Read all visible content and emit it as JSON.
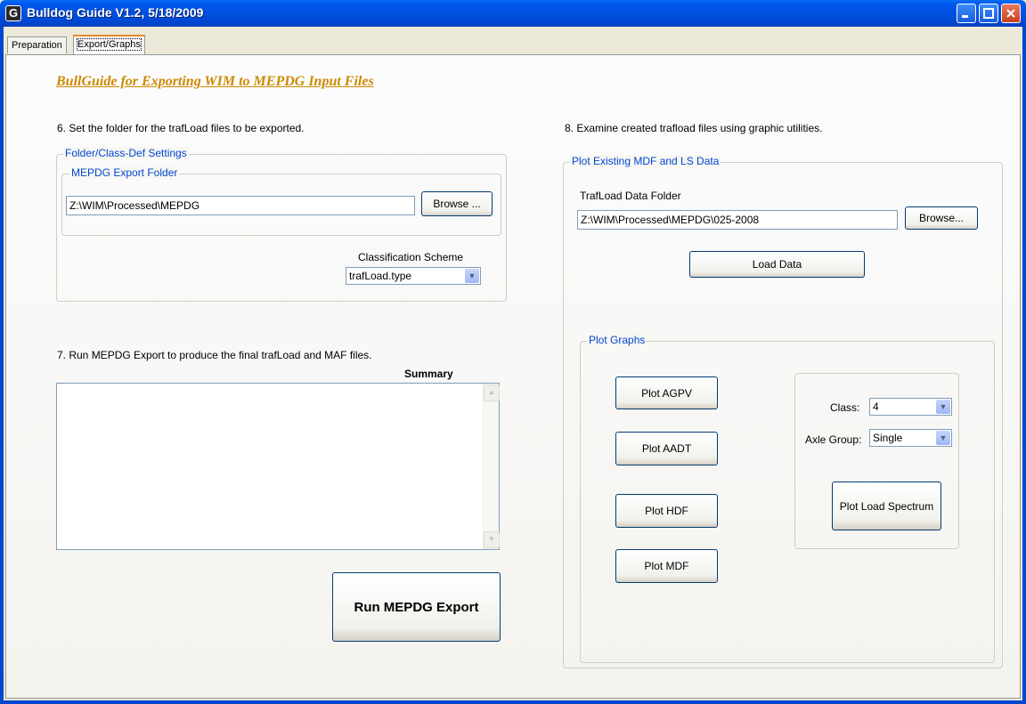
{
  "window": {
    "icon_letter": "G",
    "title": "Bulldog Guide V1.2, 5/18/2009",
    "minimize_icon": "minimize-icon",
    "maximize_icon": "maximize-icon",
    "close_icon": "close-icon"
  },
  "tabs": [
    {
      "label": "Preparation",
      "active": false
    },
    {
      "label": "Export/Graphs",
      "active": true
    }
  ],
  "heading": "BullGuide for Exporting WIM to MEPDG Input Files",
  "step6": {
    "instruction": "6. Set the folder for the trafLoad files to be exported.",
    "group_title": "Folder/Class-Def Settings",
    "subgroup_title": "MEPDG Export Folder",
    "folder_value": "Z:\\WIM\\Processed\\MEPDG",
    "browse_label": "Browse ...",
    "scheme_label": "Classification Scheme",
    "scheme_value": "trafLoad.type"
  },
  "step7": {
    "instruction": "7. Run MEPDG Export to produce the final trafLoad and MAF files.",
    "summary_label": "Summary",
    "summary_text": "",
    "run_label": "Run MEPDG Export"
  },
  "step8": {
    "instruction": "8. Examine created trafload files using graphic utilities.",
    "group_title": "Plot Existing MDF and  LS Data",
    "folder_label": "TrafLoad Data Folder",
    "folder_value": "Z:\\WIM\\Processed\\MEPDG\\025-2008",
    "browse_label": "Browse...",
    "load_label": "Load Data",
    "graphs_title": "Plot Graphs",
    "plot_agpv": "Plot AGPV",
    "plot_aadt": "Plot AADT",
    "plot_hdf": "Plot HDF",
    "plot_mdf": "Plot MDF",
    "class_label": "Class:",
    "class_value": "4",
    "axle_label": "Axle Group:",
    "axle_value": "Single",
    "plot_ls": "Plot Load Spectrum"
  },
  "colors": {
    "titlebar": "#0050E0",
    "heading": "#CC8A00",
    "legend": "#0046D5",
    "window_bg": "#ECE9D8"
  }
}
